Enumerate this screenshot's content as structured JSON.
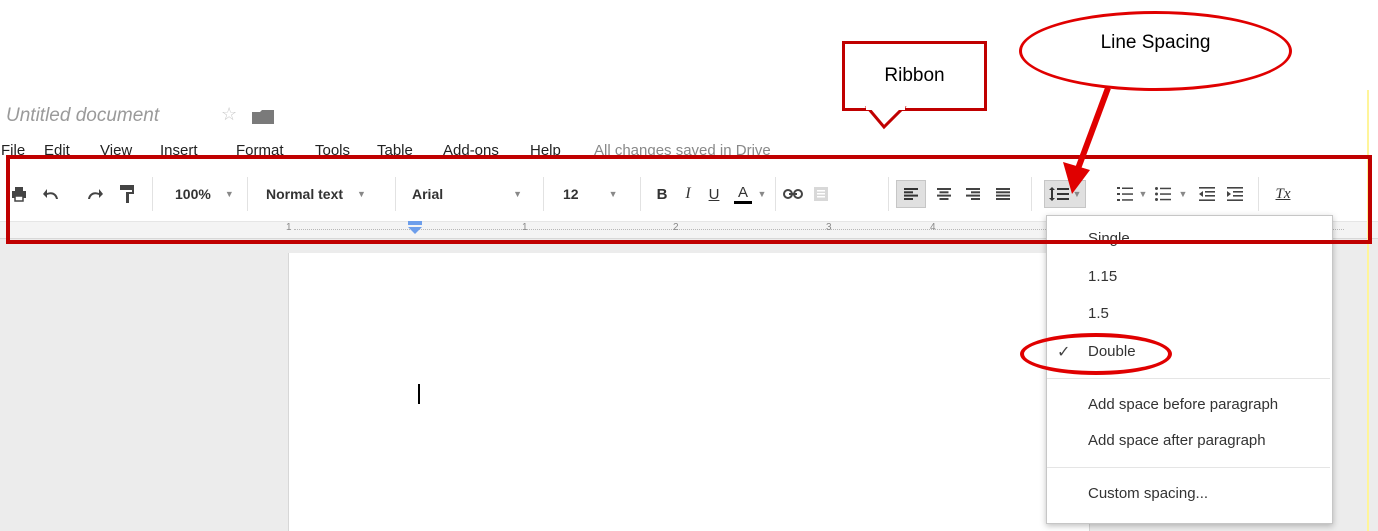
{
  "document": {
    "title": "Untitled document",
    "star_icon": "star-icon",
    "folder_icon": "folder-icon"
  },
  "menu": {
    "items": [
      "File",
      "Edit",
      "View",
      "Insert",
      "Format",
      "Tools",
      "Table",
      "Add-ons",
      "Help"
    ],
    "saved_status": "All changes saved in Drive"
  },
  "toolbar": {
    "zoom": "100%",
    "style": "Normal text",
    "font": "Arial",
    "font_size": "12",
    "bold": "B",
    "italic": "I",
    "underline": "U",
    "text_color": "A",
    "clear_formatting": "Tx",
    "icons": [
      "print-icon",
      "undo-icon",
      "redo-icon",
      "paint-format-icon",
      "link-icon",
      "comment-icon",
      "align-left-icon",
      "align-center-icon",
      "align-right-icon",
      "justify-icon",
      "line-spacing-icon",
      "numbered-list-icon",
      "bulleted-list-icon",
      "decrease-indent-icon",
      "increase-indent-icon"
    ]
  },
  "ruler": {
    "numbers": [
      "1",
      "1",
      "2",
      "3",
      "4"
    ]
  },
  "line_spacing_menu": {
    "options": [
      "Single",
      "1.15",
      "1.5",
      "Double"
    ],
    "selected": "Double",
    "add_before": "Add space before paragraph",
    "add_after": "Add space after paragraph",
    "custom": "Custom spacing..."
  },
  "annotations": {
    "ribbon_label": "Ribbon",
    "line_spacing_label": "Line Spacing",
    "color": "#c00000"
  }
}
